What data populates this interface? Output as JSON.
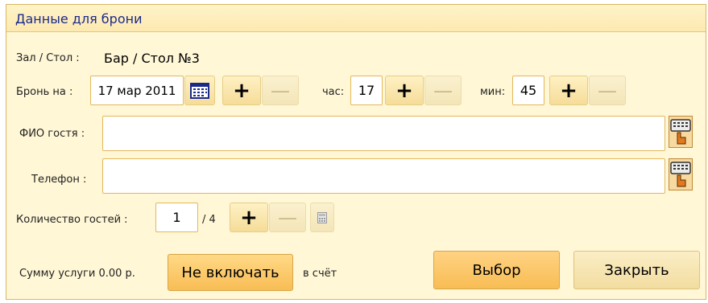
{
  "header": {
    "title": "Данные для брони"
  },
  "hall": {
    "label": "Зал / Стол :",
    "value": "Бар / Стол №3"
  },
  "booking": {
    "label": "Бронь на :",
    "date": "17 мар 2011",
    "hour_label": "час:",
    "hour": "17",
    "minute_label": "мин:",
    "minute": "45"
  },
  "guest": {
    "name_label": "ФИО гостя :",
    "name_value": "",
    "phone_label": "Телефон :",
    "phone_value": ""
  },
  "guests_count": {
    "label": "Количество гостей :",
    "value": "1",
    "max": "/ 4"
  },
  "footer": {
    "service_text": "Сумму услуги  0.00 р.",
    "exclude_button": "Не включать",
    "in_bill_text": "в счёт",
    "select_button": "Выбор",
    "close_button": "Закрыть"
  },
  "controls": {
    "plus": "+",
    "minus": "—"
  },
  "icons": [
    "calendar-icon",
    "keyboard-icon",
    "calculator-icon"
  ],
  "colors": {
    "panel_bg": "#fff7d6",
    "header_text": "#1a2a8a",
    "accent_button": "#fcc866",
    "border": "#e3b85a"
  }
}
